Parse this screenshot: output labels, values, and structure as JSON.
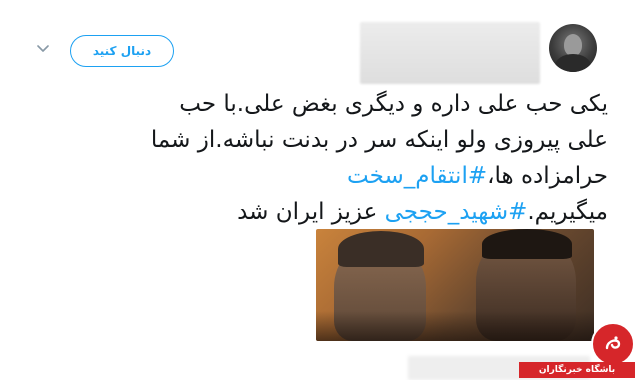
{
  "header": {
    "follow_label": "دنبال کنید"
  },
  "tweet": {
    "lines": [
      [
        {
          "text": "یکی حب علی داره و دیگری بغض علی.با حب",
          "hashtag": false
        }
      ],
      [
        {
          "text": "علی  پیروزی ولو اینکه سر در بدنت نباشه.از شما",
          "hashtag": false
        }
      ],
      [
        {
          "text": "حرامزاده ها،",
          "hashtag": false
        },
        {
          "text": "#انتقام_سخت",
          "hashtag": true
        }
      ],
      [
        {
          "text": "میگیریم.",
          "hashtag": false
        },
        {
          "text": "#شهید_حججی",
          "hashtag": true
        },
        {
          "text": " عزیز ایران شد",
          "hashtag": false
        }
      ]
    ]
  },
  "colors": {
    "accent": "#1da1f2",
    "text": "#14171a",
    "watermark": "#d6262a"
  },
  "watermark": {
    "label": "باشگاه خبرنگاران"
  }
}
